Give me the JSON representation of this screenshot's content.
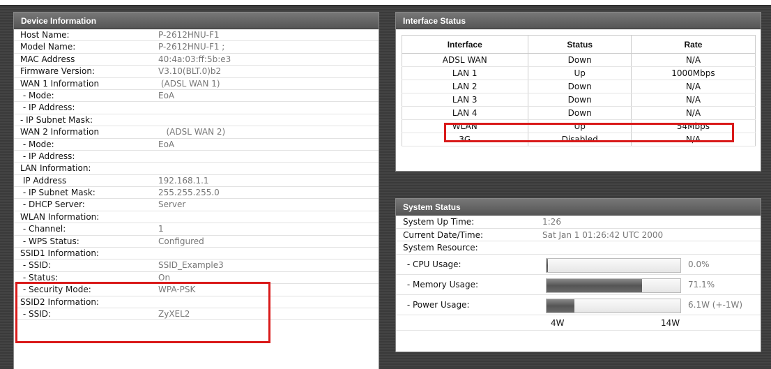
{
  "device": {
    "title": "Device Information",
    "rows": [
      {
        "label": "Host Name:",
        "value": "P-2612HNU-F1"
      },
      {
        "label": "Model Name:",
        "value": "P-2612HNU-F1 ;"
      },
      {
        "label": "MAC Address",
        "value": "40:4a:03:ff:5b:e3"
      },
      {
        "label": "Firmware Version:",
        "value": "V3.10(BLT.0)b2"
      },
      {
        "label": "WAN 1 Information",
        "value": " (ADSL WAN 1)"
      },
      {
        "label": " - Mode:",
        "value": "EoA"
      },
      {
        "label": " - IP Address:",
        "value": ""
      },
      {
        "label": "- IP Subnet Mask:",
        "value": ""
      },
      {
        "label": "WAN 2 Information",
        "value": "   (ADSL WAN 2)"
      },
      {
        "label": " - Mode:",
        "value": "EoA"
      },
      {
        "label": " - IP Address:",
        "value": ""
      },
      {
        "label": "LAN Information:",
        "value": ""
      },
      {
        "label": " IP Address",
        "value": "192.168.1.1"
      },
      {
        "label": " - IP Subnet Mask:",
        "value": "255.255.255.0"
      },
      {
        "label": " - DHCP Server:",
        "value": "Server"
      },
      {
        "label": "WLAN Information:",
        "value": ""
      },
      {
        "label": " - Channel:",
        "value": "1"
      },
      {
        "label": " - WPS Status:",
        "value": "Configured"
      },
      {
        "label": "SSID1 Information:",
        "value": ""
      },
      {
        "label": " - SSID:",
        "value": "SSID_Example3"
      },
      {
        "label": " - Status:",
        "value": "On"
      },
      {
        "label": " - Security Mode:",
        "value": "WPA-PSK"
      },
      {
        "label": "SSID2 Information:",
        "value": ""
      },
      {
        "label": " - SSID:",
        "value": "ZyXEL2"
      }
    ]
  },
  "interface": {
    "title": "Interface Status",
    "headers": [
      "Interface",
      "Status",
      "Rate"
    ],
    "rows": [
      [
        "ADSL WAN",
        "Down",
        "N/A"
      ],
      [
        "LAN 1",
        "Up",
        "1000Mbps"
      ],
      [
        "LAN 2",
        "Down",
        "N/A"
      ],
      [
        "LAN 3",
        "Down",
        "N/A"
      ],
      [
        "LAN 4",
        "Down",
        "N/A"
      ],
      [
        "WLAN",
        "Up",
        "54Mbps"
      ],
      [
        "3G",
        "Disabled",
        "N/A"
      ]
    ]
  },
  "system": {
    "title": "System Status",
    "uptime_label": "System Up Time:",
    "uptime_value": "1:26",
    "date_label": "Current Date/Time:",
    "date_value": "Sat Jan 1 01:26:42 UTC 2000",
    "resource_label": "System Resource:",
    "cpu_label": " - CPU Usage:",
    "cpu_value": "0.0%",
    "cpu_fraction": 0.01,
    "memory_label": " - Memory Usage:",
    "memory_value": "71.1%",
    "memory_fraction": 0.711,
    "power_label": " - Power Usage:",
    "power_value": "6.1W (+-1W)",
    "power_fraction": 0.21,
    "scale_min": "4W",
    "scale_max": "14W"
  },
  "colors": {
    "highlight": "#d91a1a",
    "header": "#666666"
  }
}
